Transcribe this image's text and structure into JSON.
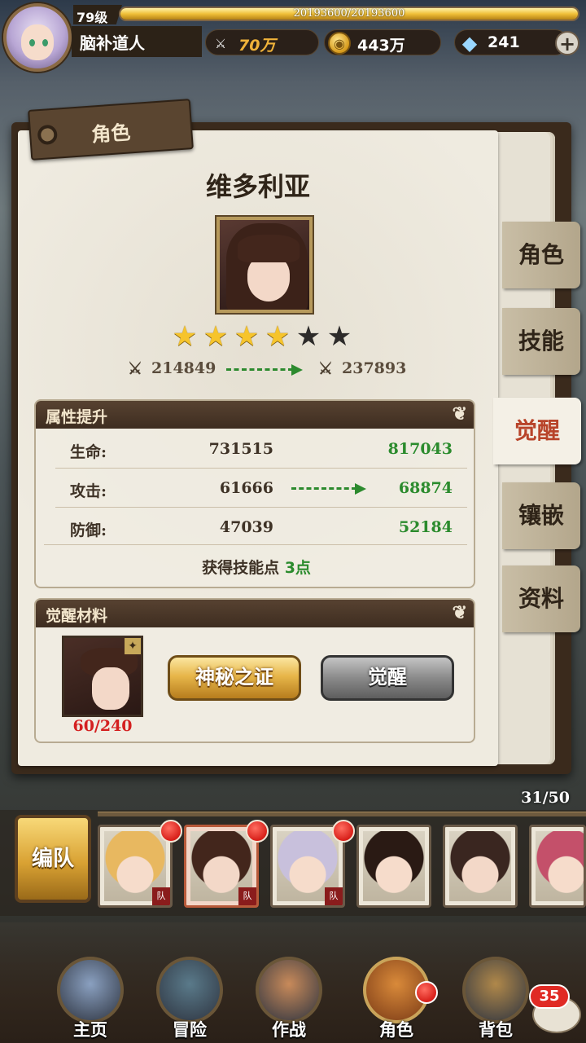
{
  "player": {
    "level": "79级",
    "xp_text": "20193600/20193600",
    "xp_fraction": 1.0,
    "name": "脑补道人"
  },
  "resources": {
    "power": "70万",
    "gold": "443万",
    "gems": "241"
  },
  "panel": {
    "title": "角色",
    "char_name": "维多利亚",
    "stars_total": 6,
    "stars_filled": 4,
    "power_current": "214849",
    "power_next": "237893"
  },
  "attributes": {
    "header": "属性提升",
    "rows": [
      {
        "label": "生命:",
        "current": "731515",
        "next": "817043"
      },
      {
        "label": "攻击:",
        "current": "61666",
        "next": "68874"
      },
      {
        "label": "防御:",
        "current": "47039",
        "next": "52184"
      }
    ],
    "skill_prefix": "获得技能点",
    "skill_value": "3点"
  },
  "materials": {
    "header": "觉醒材料",
    "count": "60/240",
    "btn_proof": "神秘之证",
    "btn_awaken": "觉醒"
  },
  "side_tabs": [
    "角色",
    "技能",
    "觉醒",
    "镶嵌",
    "资料"
  ],
  "side_tab_active": 2,
  "team": {
    "button": "编队",
    "count": "31/50",
    "card_tag": "队"
  },
  "nav": {
    "items": [
      "主页",
      "冒险",
      "作战",
      "角色",
      "背包"
    ],
    "active": 3,
    "message_badge": "35"
  },
  "colors": {
    "accent_gold": "#e7b64a",
    "increase_green": "#2b8b2d",
    "material_red": "#d42020",
    "active_tab_text": "#b8442a"
  }
}
